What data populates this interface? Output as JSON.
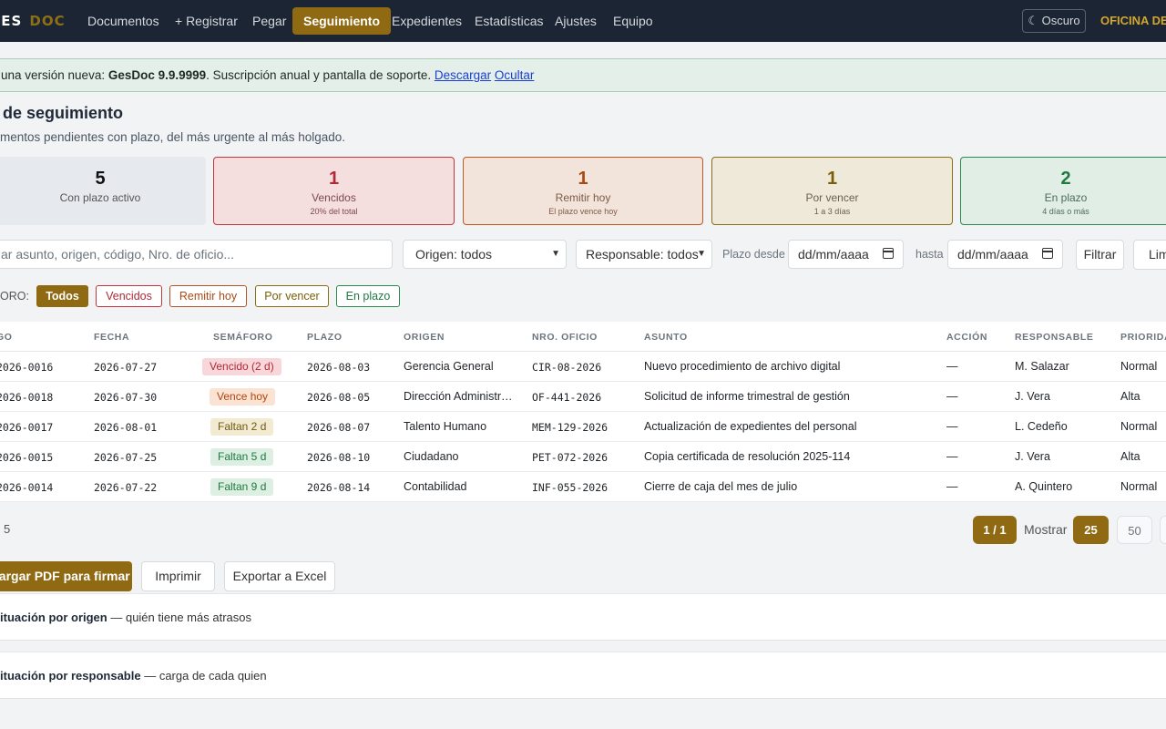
{
  "nav": {
    "brand_left": "GES",
    "brand_right": "DOC",
    "items": [
      "Documentos",
      "+ Registrar",
      "Pegar",
      "Seguimiento",
      "Expedientes",
      "Estadísticas",
      "Ajustes",
      "Equipo"
    ],
    "active": "Seguimiento",
    "theme_button": "☾ Oscuro",
    "office": "OFICINA DE P"
  },
  "alert": {
    "prefix": "una versión nueva: ",
    "version": "GesDoc 9.9.9999",
    "suffix": ". Suscripción anual y pantalla de soporte. ",
    "download": "Descargar",
    "hide": "Ocultar"
  },
  "page": {
    "title": "de seguimiento",
    "subtitle": "mentos pendientes con plazo, del más urgente al más holgado."
  },
  "stats": {
    "active": {
      "value": "5",
      "label": "Con plazo activo"
    },
    "vencidos": {
      "value": "1",
      "label": "Vencidos",
      "sub": "20% del total"
    },
    "remitir": {
      "value": "1",
      "label": "Remitir hoy",
      "sub": "El plazo vence hoy"
    },
    "porvencer": {
      "value": "1",
      "label": "Por vencer",
      "sub": "1 a 3 días"
    },
    "enplazo": {
      "value": "2",
      "label": "En plazo",
      "sub": "4 días o más"
    }
  },
  "filters": {
    "search_placeholder": "ar asunto, origen, código, Nro. de oficio...",
    "origin": "Origen: todos",
    "responsible": "Responsable: todos",
    "from_label": "Plazo desde",
    "from_value": "dd/mm/aaaa",
    "to_label": "hasta",
    "to_value": "dd/mm/aaaa",
    "filter_button": "Filtrar",
    "clear_button": "Limpiar"
  },
  "semaforo": {
    "label": "ORO:",
    "chips": [
      "Todos",
      "Vencidos",
      "Remitir hoy",
      "Por vencer",
      "En plazo"
    ],
    "selected": "Todos"
  },
  "table": {
    "headers": [
      "GO",
      "FECHA",
      "SEMÁFORO",
      "PLAZO",
      "ORIGEN",
      "NRO. OFICIO",
      "ASUNTO",
      "ACCIÓN",
      "RESPONSABLE",
      "PRIORIDA"
    ],
    "rows": [
      {
        "code": "2026-0016",
        "fecha": "2026-07-27",
        "semaforo": "Vencido (2 d)",
        "status": "vencido",
        "plazo": "2026-08-03",
        "origen": "Gerencia General",
        "oficio": "CIR-08-2026",
        "asunto": "Nuevo procedimiento de archivo digital",
        "accion": "—",
        "responsable": "M. Salazar",
        "prioridad": "Normal"
      },
      {
        "code": "2026-0018",
        "fecha": "2026-07-30",
        "semaforo": "Vence hoy",
        "status": "hoy",
        "plazo": "2026-08-05",
        "origen": "Dirección Administrativa",
        "oficio": "OF-441-2026",
        "asunto": "Solicitud de informe trimestral de gestión",
        "accion": "—",
        "responsable": "J. Vera",
        "prioridad": "Alta"
      },
      {
        "code": "2026-0017",
        "fecha": "2026-08-01",
        "semaforo": "Faltan 2 d",
        "status": "porvencer",
        "plazo": "2026-08-07",
        "origen": "Talento Humano",
        "oficio": "MEM-129-2026",
        "asunto": "Actualización de expedientes del personal",
        "accion": "—",
        "responsable": "L. Cedeño",
        "prioridad": "Normal"
      },
      {
        "code": "2026-0015",
        "fecha": "2026-07-25",
        "semaforo": "Faltan 5 d",
        "status": "enplazo",
        "plazo": "2026-08-10",
        "origen": "Ciudadano",
        "oficio": "PET-072-2026",
        "asunto": "Copia certificada de resolución 2025-114",
        "accion": "—",
        "responsable": "J. Vera",
        "prioridad": "Alta"
      },
      {
        "code": "2026-0014",
        "fecha": "2026-07-22",
        "semaforo": "Faltan 9 d",
        "status": "enplazo",
        "plazo": "2026-08-14",
        "origen": "Contabilidad",
        "oficio": "INF-055-2026",
        "asunto": "Cierre de caja del mes de julio",
        "accion": "—",
        "responsable": "A. Quintero",
        "prioridad": "Normal"
      }
    ]
  },
  "pagination": {
    "count": "5",
    "current": "1 / 1",
    "show_label": "Mostrar",
    "sizes": [
      "25",
      "50"
    ],
    "selected_size": "25"
  },
  "actions": {
    "pdf": "cargar PDF para firmar",
    "print": "Imprimir",
    "excel": "Exportar a Excel"
  },
  "sections": {
    "by_origin_title": "ituación por origen",
    "by_origin_note": " — quién tiene más atrasos",
    "by_resp_title": "ituación por responsable",
    "by_resp_note": " — carga de cada quien"
  }
}
